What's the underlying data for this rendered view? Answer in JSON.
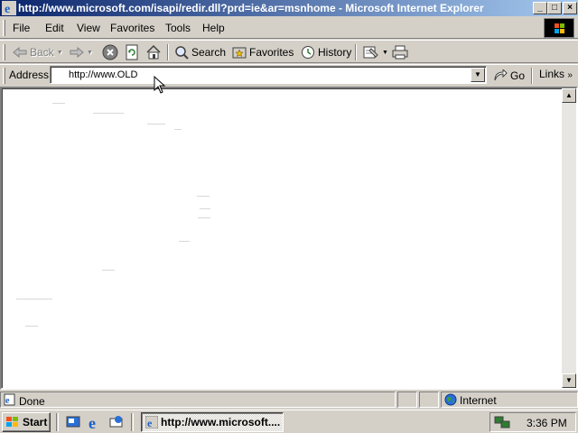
{
  "window": {
    "title": "http://www.microsoft.com/isapi/redir.dll?prd=ie&ar=msnhome - Microsoft Internet Explorer",
    "controls": {
      "minimize": "_",
      "maximize": "□",
      "close": "×"
    }
  },
  "menu": {
    "items": [
      {
        "label": "File"
      },
      {
        "label": "Edit"
      },
      {
        "label": "View"
      },
      {
        "label": "Favorites"
      },
      {
        "label": "Tools"
      },
      {
        "label": "Help"
      }
    ]
  },
  "toolbar": {
    "back_label": "Back",
    "search_label": "Search",
    "favorites_label": "Favorites",
    "history_label": "History",
    "icons": [
      "back-arrow-icon",
      "forward-arrow-icon",
      "stop-icon",
      "refresh-icon",
      "home-icon",
      "search-icon",
      "favorites-icon",
      "history-icon",
      "mail-icon",
      "print-icon"
    ]
  },
  "address": {
    "label": "Address",
    "value": "http://www.OLD",
    "go_label": "Go",
    "links_label": "Links"
  },
  "status": {
    "text": "Done",
    "zone": "Internet"
  },
  "taskbar": {
    "start_label": "Start",
    "task_label": "http://www.microsoft....",
    "clock": "3:36 PM"
  },
  "colors": {
    "titlebar_start": "#0a246a",
    "titlebar_end": "#a6caf0",
    "chrome": "#d4d0c8"
  }
}
